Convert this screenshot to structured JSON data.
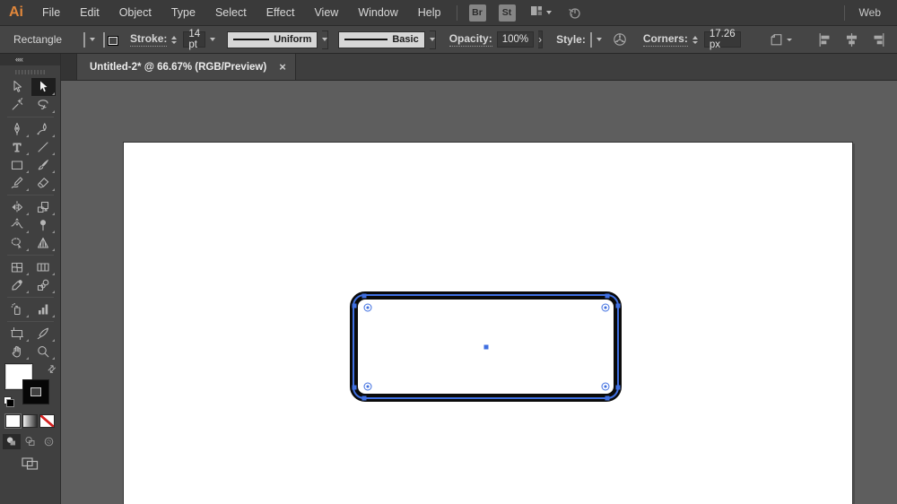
{
  "app": {
    "logo_text": "Ai",
    "workspace_label": "Web",
    "bridge_label": "Br",
    "stock_label": "St"
  },
  "menubar": {
    "items": [
      "File",
      "Edit",
      "Object",
      "Type",
      "Select",
      "Effect",
      "View",
      "Window",
      "Help"
    ]
  },
  "options": {
    "tool_name": "Rectangle",
    "stroke_label": "Stroke:",
    "stroke_weight": "14 pt",
    "width_profile": "Uniform",
    "brush_style": "Basic",
    "opacity_label": "Opacity:",
    "opacity_value": "100%",
    "opacity_more_glyph": "›",
    "style_label": "Style:",
    "corners_label": "Corners:",
    "corners_value": "17.26 px"
  },
  "document_tab": {
    "title": "Untitled-2* @ 66.67% (RGB/Preview)",
    "close_glyph": "×"
  },
  "toolbar": {
    "collapse_glyph": "««",
    "tools": [
      "selection",
      "direct-selection",
      "magic-wand",
      "lasso",
      "pen",
      "curvature",
      "type",
      "line-segment",
      "rectangle",
      "paintbrush",
      "pencil",
      "eraser",
      "reflect",
      "scale",
      "width",
      "puppet-warp",
      "shape-builder",
      "perspective-grid",
      "mesh",
      "gradient",
      "eyedropper",
      "blend",
      "symbol-sprayer",
      "column-graph",
      "artboard",
      "slice",
      "hand",
      "zoom"
    ],
    "selected_tool": "direct-selection",
    "swap_glyph": "⇄"
  },
  "selection": {
    "fill_color": "#ffffff",
    "stroke_color": "#0a0a0a",
    "accent_blue": "#3f6fe0"
  },
  "colors": {
    "canvas_gray": "#5e5e5e",
    "logo_orange": "#e1873b",
    "menubar_bg": "#3a3a3a",
    "optionsbar_bg": "#454545"
  }
}
